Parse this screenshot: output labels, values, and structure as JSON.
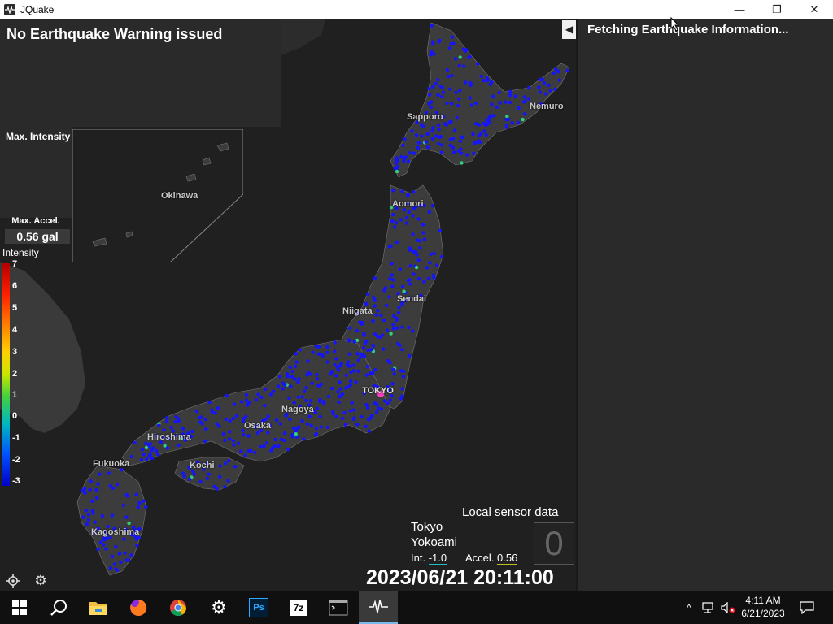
{
  "window": {
    "title": "JQuake",
    "minimize_glyph": "—",
    "restore_glyph": "❐",
    "close_glyph": "✕"
  },
  "map": {
    "warning_text": "No Earthquake Warning issued",
    "max_intensity_label": "Max. Intensity",
    "max_accel_label": "Max. Accel.",
    "max_accel_value": "0.56 gal",
    "intensity_title": "Intensity",
    "scale_labels": [
      "7",
      "6",
      "5",
      "4",
      "3",
      "2",
      "1",
      "0",
      "-1",
      "-2",
      "-3"
    ],
    "cities": [
      "Sapporo",
      "Nemuro",
      "Okinawa",
      "Aomori",
      "Sendai",
      "Niigata",
      "TOKYO",
      "Nagoya",
      "Osaka",
      "Hiroshima",
      "Kochi",
      "Fukuoka",
      "Kagoshima"
    ],
    "colors": {
      "station_default": "#1414ff",
      "station_active": "#30d080",
      "tokyo_marker": "#ff40c0",
      "land": "#3c3c3c",
      "sea": "#202020"
    }
  },
  "sensor": {
    "title": "Local sensor data",
    "location_line1": "Tokyo",
    "location_line2": "Yokoami",
    "int_label": "Int.",
    "int_value": "-1.0",
    "accel_label": "Accel.",
    "accel_value": "0.56",
    "shindo": "0"
  },
  "datetime": "2023/06/21 20:11:00",
  "controls": {
    "locate_icon": "crosshair-icon",
    "settings_icon": "gear-icon"
  },
  "side_panel": {
    "status_text": "Fetching Earthquake Information...",
    "collapse_glyph": "◀"
  },
  "taskbar": {
    "apps": [
      "start-icon",
      "search-icon",
      "file-explorer-icon",
      "firefox-icon",
      "chrome-icon",
      "settings-icon",
      "photoshop-icon",
      "7zip-icon",
      "terminal-icon",
      "jquake-icon"
    ],
    "ps_label": "Ps",
    "sevenzip_label": "7z",
    "clock_time": "4:11 AM",
    "clock_date": "6/21/2023"
  }
}
